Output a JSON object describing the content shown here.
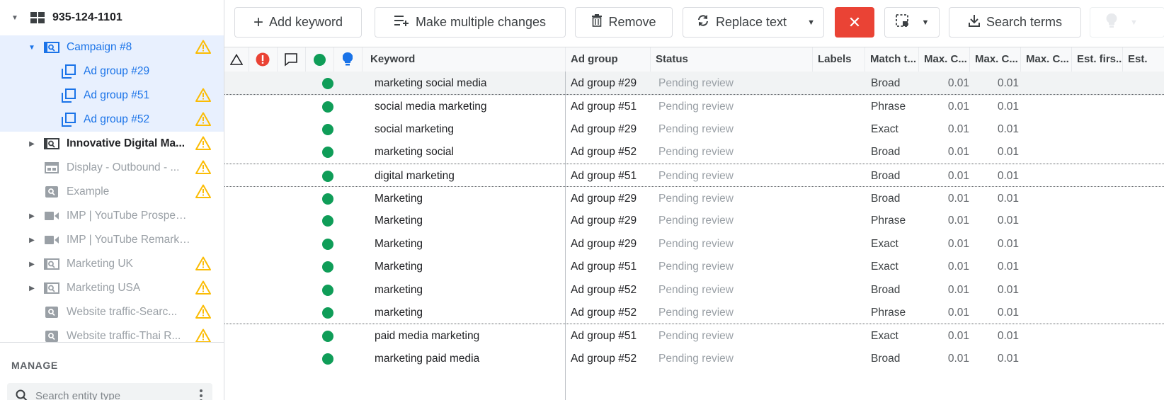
{
  "sidebar": {
    "account": {
      "label": "935-124-1101"
    },
    "campaigns": [
      {
        "label": "Campaign #8",
        "type": "search",
        "state": "selected",
        "expanded": true,
        "warning": true,
        "children": [
          {
            "label": "Ad group #29",
            "warning": false
          },
          {
            "label": "Ad group #51",
            "warning": true
          },
          {
            "label": "Ad group #52",
            "warning": true
          }
        ]
      },
      {
        "label": "Innovative Digital Ma...",
        "type": "search",
        "state": "bold",
        "expandable": true,
        "warning": true
      },
      {
        "label": "Display - Outbound - ...",
        "type": "display",
        "state": "grey",
        "expandable": false,
        "warning": true
      },
      {
        "label": "Example",
        "type": "search-small",
        "state": "grey",
        "expandable": false,
        "warning": true
      },
      {
        "label": "IMP | YouTube Prospecting",
        "type": "video",
        "state": "grey",
        "expandable": true,
        "warning": false
      },
      {
        "label": "IMP | YouTube Remarketi...",
        "type": "video",
        "state": "grey",
        "expandable": true,
        "warning": false
      },
      {
        "label": "Marketing UK",
        "type": "search",
        "state": "grey",
        "expandable": true,
        "warning": true
      },
      {
        "label": "Marketing USA",
        "type": "search",
        "state": "grey",
        "expandable": true,
        "warning": true
      },
      {
        "label": "Website traffic-Searc...",
        "type": "search-small",
        "state": "grey",
        "expandable": false,
        "warning": true
      },
      {
        "label": "Website traffic-Thai R...",
        "type": "search-small",
        "state": "grey",
        "expandable": false,
        "warning": true
      }
    ],
    "manage_label": "MANAGE",
    "search_placeholder": "Search entity type"
  },
  "toolbar": {
    "add_keyword": "Add keyword",
    "make_multiple_changes": "Make multiple changes",
    "remove": "Remove",
    "replace_text": "Replace text",
    "search_terms": "Search terms"
  },
  "table": {
    "headers": {
      "keyword": "Keyword",
      "ad_group": "Ad group",
      "status": "Status",
      "labels": "Labels",
      "match_type": "Match t...",
      "max_cpc_1": "Max. C...",
      "max_cpc_2": "Max. C...",
      "max_cpc_3": "Max. C...",
      "est_first": "Est. firs...",
      "est": "Est."
    },
    "rows": [
      {
        "keyword": "marketing social media",
        "ad_group": "Ad group #29",
        "status": "Pending review",
        "match_type": "Broad",
        "max_cpc": "0.01",
        "max_cpc_2": "0.01"
      },
      {
        "keyword": "social media marketing",
        "ad_group": "Ad group #51",
        "status": "Pending review",
        "match_type": "Phrase",
        "max_cpc": "0.01",
        "max_cpc_2": "0.01"
      },
      {
        "keyword": "social marketing",
        "ad_group": "Ad group #29",
        "status": "Pending review",
        "match_type": "Exact",
        "max_cpc": "0.01",
        "max_cpc_2": "0.01"
      },
      {
        "keyword": "marketing social",
        "ad_group": "Ad group #52",
        "status": "Pending review",
        "match_type": "Broad",
        "max_cpc": "0.01",
        "max_cpc_2": "0.01"
      },
      {
        "keyword": "digital marketing",
        "ad_group": "Ad group #51",
        "status": "Pending review",
        "match_type": "Broad",
        "max_cpc": "0.01",
        "max_cpc_2": "0.01"
      },
      {
        "keyword": "Marketing",
        "ad_group": "Ad group #29",
        "status": "Pending review",
        "match_type": "Broad",
        "max_cpc": "0.01",
        "max_cpc_2": "0.01"
      },
      {
        "keyword": "Marketing",
        "ad_group": "Ad group #29",
        "status": "Pending review",
        "match_type": "Phrase",
        "max_cpc": "0.01",
        "max_cpc_2": "0.01"
      },
      {
        "keyword": "Marketing",
        "ad_group": "Ad group #29",
        "status": "Pending review",
        "match_type": "Exact",
        "max_cpc": "0.01",
        "max_cpc_2": "0.01"
      },
      {
        "keyword": "Marketing",
        "ad_group": "Ad group #51",
        "status": "Pending review",
        "match_type": "Exact",
        "max_cpc": "0.01",
        "max_cpc_2": "0.01"
      },
      {
        "keyword": "marketing",
        "ad_group": "Ad group #52",
        "status": "Pending review",
        "match_type": "Broad",
        "max_cpc": "0.01",
        "max_cpc_2": "0.01"
      },
      {
        "keyword": "marketing",
        "ad_group": "Ad group #52",
        "status": "Pending review",
        "match_type": "Phrase",
        "max_cpc": "0.01",
        "max_cpc_2": "0.01"
      },
      {
        "keyword": "paid media marketing",
        "ad_group": "Ad group #51",
        "status": "Pending review",
        "match_type": "Exact",
        "max_cpc": "0.01",
        "max_cpc_2": "0.01"
      },
      {
        "keyword": "marketing paid media",
        "ad_group": "Ad group #52",
        "status": "Pending review",
        "match_type": "Broad",
        "max_cpc": "0.01",
        "max_cpc_2": "0.01"
      }
    ]
  },
  "colors": {
    "accent": "#1a73e8",
    "selected_bg": "#e8f0fe",
    "warning": "#fbbc04",
    "status_enabled": "#0f9d58",
    "error": "#ea4335"
  }
}
